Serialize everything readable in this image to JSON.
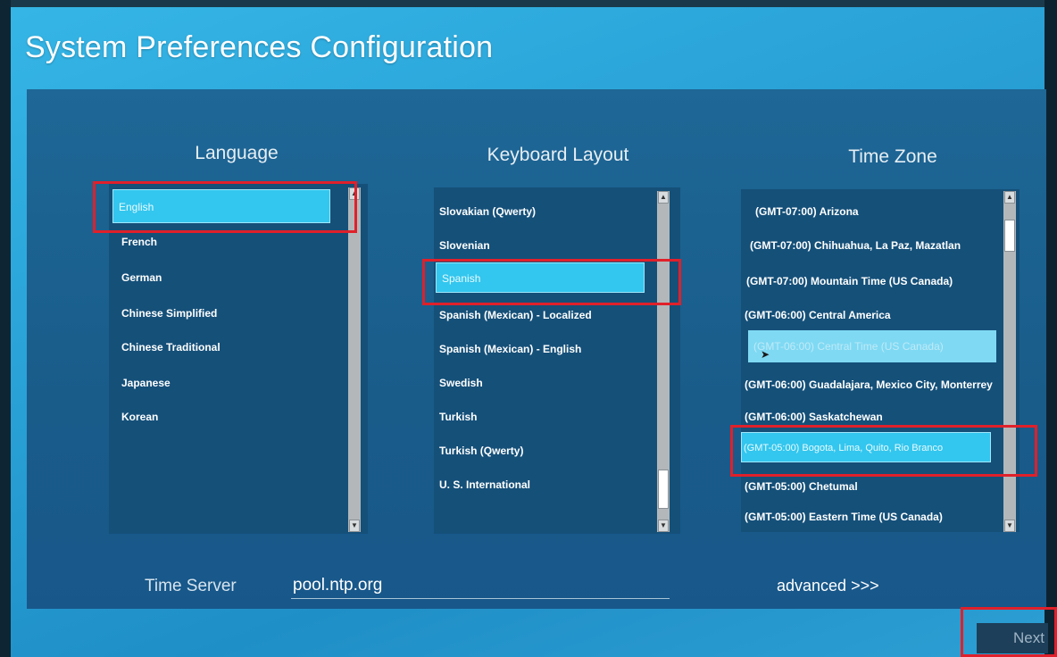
{
  "window": {
    "title": "System Preferences Configuration"
  },
  "language": {
    "heading": "Language",
    "items": [
      "English",
      "French",
      "German",
      "Chinese Simplified",
      "Chinese Traditional",
      "Japanese",
      "Korean"
    ],
    "selected": "English"
  },
  "keyboard": {
    "heading": "Keyboard Layout",
    "items": [
      "Slovakian (Qwerty)",
      "Slovenian",
      "Spanish",
      "Spanish (Mexican) - Localized",
      "Spanish (Mexican) - English",
      "Swedish",
      "Turkish",
      "Turkish (Qwerty)",
      "U. S. International"
    ],
    "selected": "Spanish"
  },
  "timezone": {
    "heading": "Time Zone",
    "items": [
      "(GMT-07:00) Arizona",
      "(GMT-07:00) Chihuahua, La Paz, Mazatlan",
      "(GMT-07:00) Mountain Time (US Canada)",
      "(GMT-06:00) Central America",
      "(GMT-06:00) Central Time (US Canada)",
      "(GMT-06:00) Guadalajara, Mexico City, Monterrey",
      "(GMT-06:00) Saskatchewan",
      "(GMT-05:00) Bogota, Lima, Quito, Rio Branco",
      "(GMT-05:00) Chetumal",
      "(GMT-05:00) Eastern Time (US Canada)"
    ],
    "selected": "(GMT-05:00) Bogota, Lima, Quito, Rio Branco",
    "hover": "(GMT-06:00) Central Time (US Canada)"
  },
  "time_server": {
    "label": "Time Server",
    "value": "pool.ntp.org"
  },
  "advanced_label": "advanced >>>",
  "next_label": "Next",
  "colors": {
    "accent": "#33c6ee",
    "highlight": "#e0202a",
    "panel": "#1a5f8e"
  }
}
